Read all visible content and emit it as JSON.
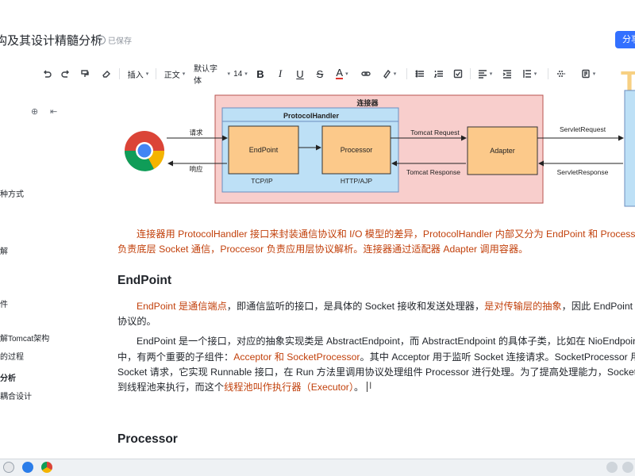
{
  "header": {
    "title": "构及其设计精髓分析",
    "save_status": "已保存",
    "share_label": "分享"
  },
  "toolbar": {
    "insert_label": "插入",
    "paragraph_label": "正文",
    "font_label": "默认字体",
    "font_size": "14"
  },
  "sidebar": {
    "items": [
      {
        "label": "种方式"
      },
      {
        "label": "解"
      },
      {
        "label": "件"
      },
      {
        "label": "解Tomcat架构"
      },
      {
        "label": "的过程"
      },
      {
        "label": "分析"
      },
      {
        "label": "耦合设计"
      }
    ]
  },
  "diagram": {
    "connector_title": "连接器",
    "protocol_handler_title": "ProtocolHandler",
    "endpoint_label": "EndPoint",
    "processor_label": "Processor",
    "adapter_label": "Adapter",
    "tcp_label": "TCP/IP",
    "http_label": "HTTP/AJP",
    "request_label": "请求",
    "response_label": "响应",
    "tomcat_request": "Tomcat Request",
    "tomcat_response": "Tomcat Response",
    "servlet_request": "ServletRequest",
    "servlet_response": "ServletResponse",
    "colors": {
      "connector_bg": "#f8cecc",
      "protocol_bg": "#bde0f6",
      "box_bg": "#fcc98a",
      "right_box_bg": "#bde0f6"
    }
  },
  "body": {
    "p1_line1": "连接器用 ProtocolHandler 接口来封装通信协议和 I/O 模型的差异，ProtocolHandler 内部又分为 EndPoint 和 Processor",
    "p1_line2": "负责底层 Socket 通信，Proccesor 负责应用层协议解析。连接器通过适配器 Adapter 调用容器。",
    "h_endpoint": "EndPoint",
    "p2_a": "EndPoint 是通信端点",
    "p2_b": "，即通信监听的接口，是具体的 Socket 接收和发送处理器，",
    "p2_c": "是对传输层的抽象",
    "p2_d": "，因此 EndPoint 是",
    "p2_line2": "协议的。",
    "p3_line1": "EndPoint 是一个接口，对应的抽象实现类是 AbstractEndpoint，而 AbstractEndpoint 的具体子类，比如在 NioEndpoint",
    "p3_line2_a": "中，有两个重要的子组件：",
    "p3_line2_b": "Acceptor 和 SocketProcessor",
    "p3_line2_c": "。其中 Acceptor 用于监听 Socket 连接请求。SocketProcessor 用于",
    "p3_line3": "Socket 请求，它实现 Runnable 接口，在 Run 方法里调用协议处理组件 Processor 进行处理。为了提高处理能力，Socket",
    "p3_line4_a": "到线程池来执行，而这个",
    "p3_line4_b": "线程池叫作执行器（Executor）",
    "p3_line4_c": "。",
    "h_processor": "Processor"
  }
}
